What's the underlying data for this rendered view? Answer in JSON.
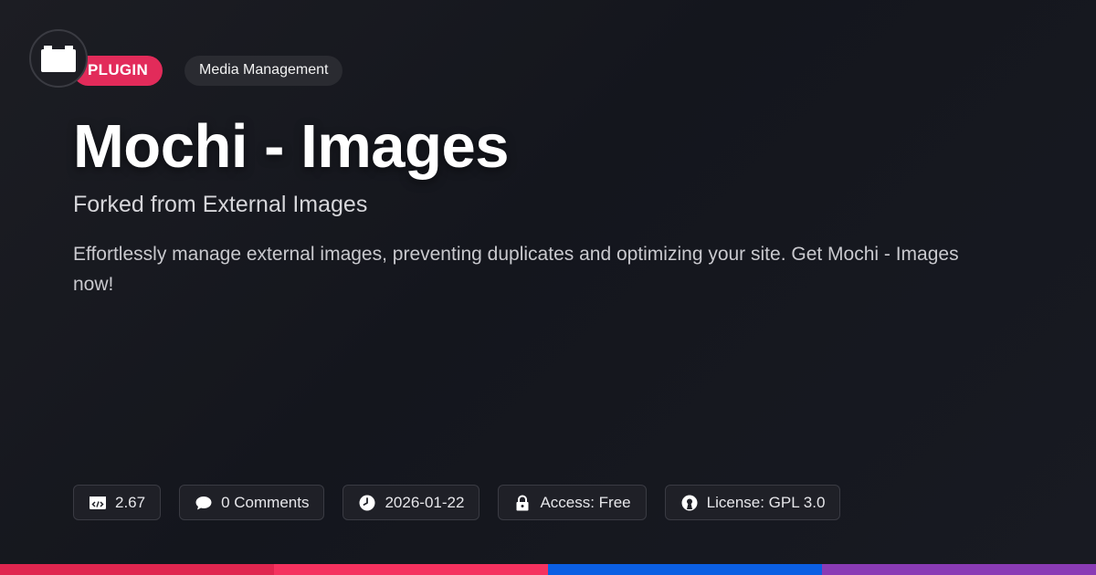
{
  "logo": {
    "icon": "plugin-block-icon"
  },
  "badges": {
    "type_label": "PLUGIN",
    "category_label": "Media Management"
  },
  "title": "Mochi - Images",
  "subtitle": "Forked from External Images",
  "description": "Effortlessly manage external images, preventing duplicates and optimizing your site. Get Mochi - Images now!",
  "meta": [
    {
      "icon": "code-icon",
      "label": "2.67"
    },
    {
      "icon": "comment-icon",
      "label": "0 Comments"
    },
    {
      "icon": "clock-icon",
      "label": "2026-01-22"
    },
    {
      "icon": "lock-icon",
      "label": "Access: Free"
    },
    {
      "icon": "license-icon",
      "label": "License: GPL 3.0"
    }
  ],
  "colors": {
    "accent": "#e22b5a",
    "bar": [
      "#e0264f",
      "#f5325f",
      "#0b5fe3",
      "#8a3bb5"
    ]
  }
}
